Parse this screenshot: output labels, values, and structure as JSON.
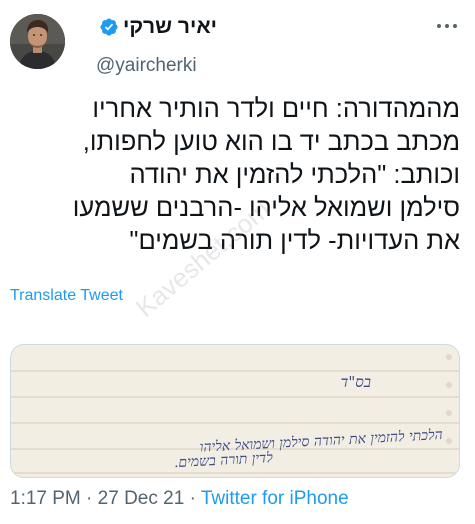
{
  "author": {
    "name": "יאיר שרקי",
    "handle": "@yaircherki"
  },
  "tweet": {
    "lines": [
      "מהמהדורה: חיים ולדר הותיר אחריו",
      "מכתב בכתב יד בו הוא טוען לחפותו,",
      "וכותב: \"הלכתי להזמין את יהודה",
      "סילמן ושמואל אליהו -הרבנים ששמעו",
      "את העדויות- לדין תורה בשמים\""
    ],
    "translate_label": "Translate Tweet"
  },
  "media": {
    "handwritten_lines": [
      "בס\"ד",
      "הלכתי להזמין את יהודה סילמן ושמואל אליהו",
      "לדין תורה בשמים."
    ]
  },
  "meta": {
    "time": "1:17 PM",
    "separator": "·",
    "date": "27 Dec 21",
    "source": "Twitter for iPhone"
  },
  "watermark": "Kaveshet.com",
  "colors": {
    "accent": "#1d9bf0",
    "secondary_text": "#536471",
    "primary_text": "#0f1419",
    "border": "#cfd9de"
  }
}
